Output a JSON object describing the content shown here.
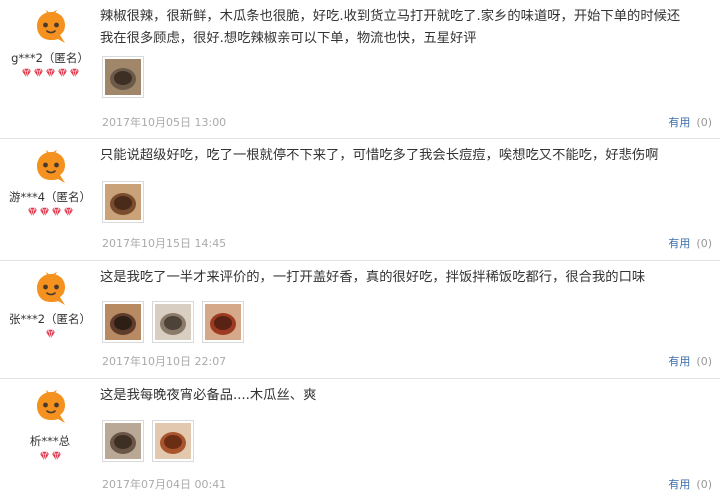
{
  "colors": {
    "avatar_orange": "#f5911e",
    "avatar_dark": "#4a3a2e",
    "gem_red": "#e2364c",
    "link_blue": "#3b6ea8",
    "date_gray": "#aaaaaa"
  },
  "reviews": [
    {
      "user": "g***2（匿名）",
      "level_gems": 5,
      "text": "辣椒很辣，很新鲜，木瓜条也很脆，好吃.收到货立马打开就吃了.家乡的味道呀，开始下单的时候还我在很多顾虑，很好.想吃辣椒亲可以下单，物流也快，五星好评",
      "images": 1,
      "date": "2017年10月05日 13:00",
      "useful_label": "有用",
      "useful_count": "(0)"
    },
    {
      "user": "游***4（匿名）",
      "level_gems": 4,
      "text": "只能说超级好吃，吃了一根就停不下来了，可惜吃多了我会长痘痘，唉想吃又不能吃，好悲伤啊",
      "images": 1,
      "date": "2017年10月15日 14:45",
      "useful_label": "有用",
      "useful_count": "(0)"
    },
    {
      "user": "张***2（匿名）",
      "level_gems": 1,
      "text": "这是我吃了一半才来评价的，一打开盖好香，真的很好吃，拌饭拌稀饭吃都行，很合我的口味",
      "images": 3,
      "date": "2017年10月10日 22:07",
      "useful_label": "有用",
      "useful_count": "(0)"
    },
    {
      "user": "析***总",
      "level_gems": 2,
      "text": "这是我每晚夜宵必备品....木瓜丝、爽",
      "images": 2,
      "date": "2017年07月04日 00:41",
      "useful_label": "有用",
      "useful_count": "(0)"
    }
  ]
}
